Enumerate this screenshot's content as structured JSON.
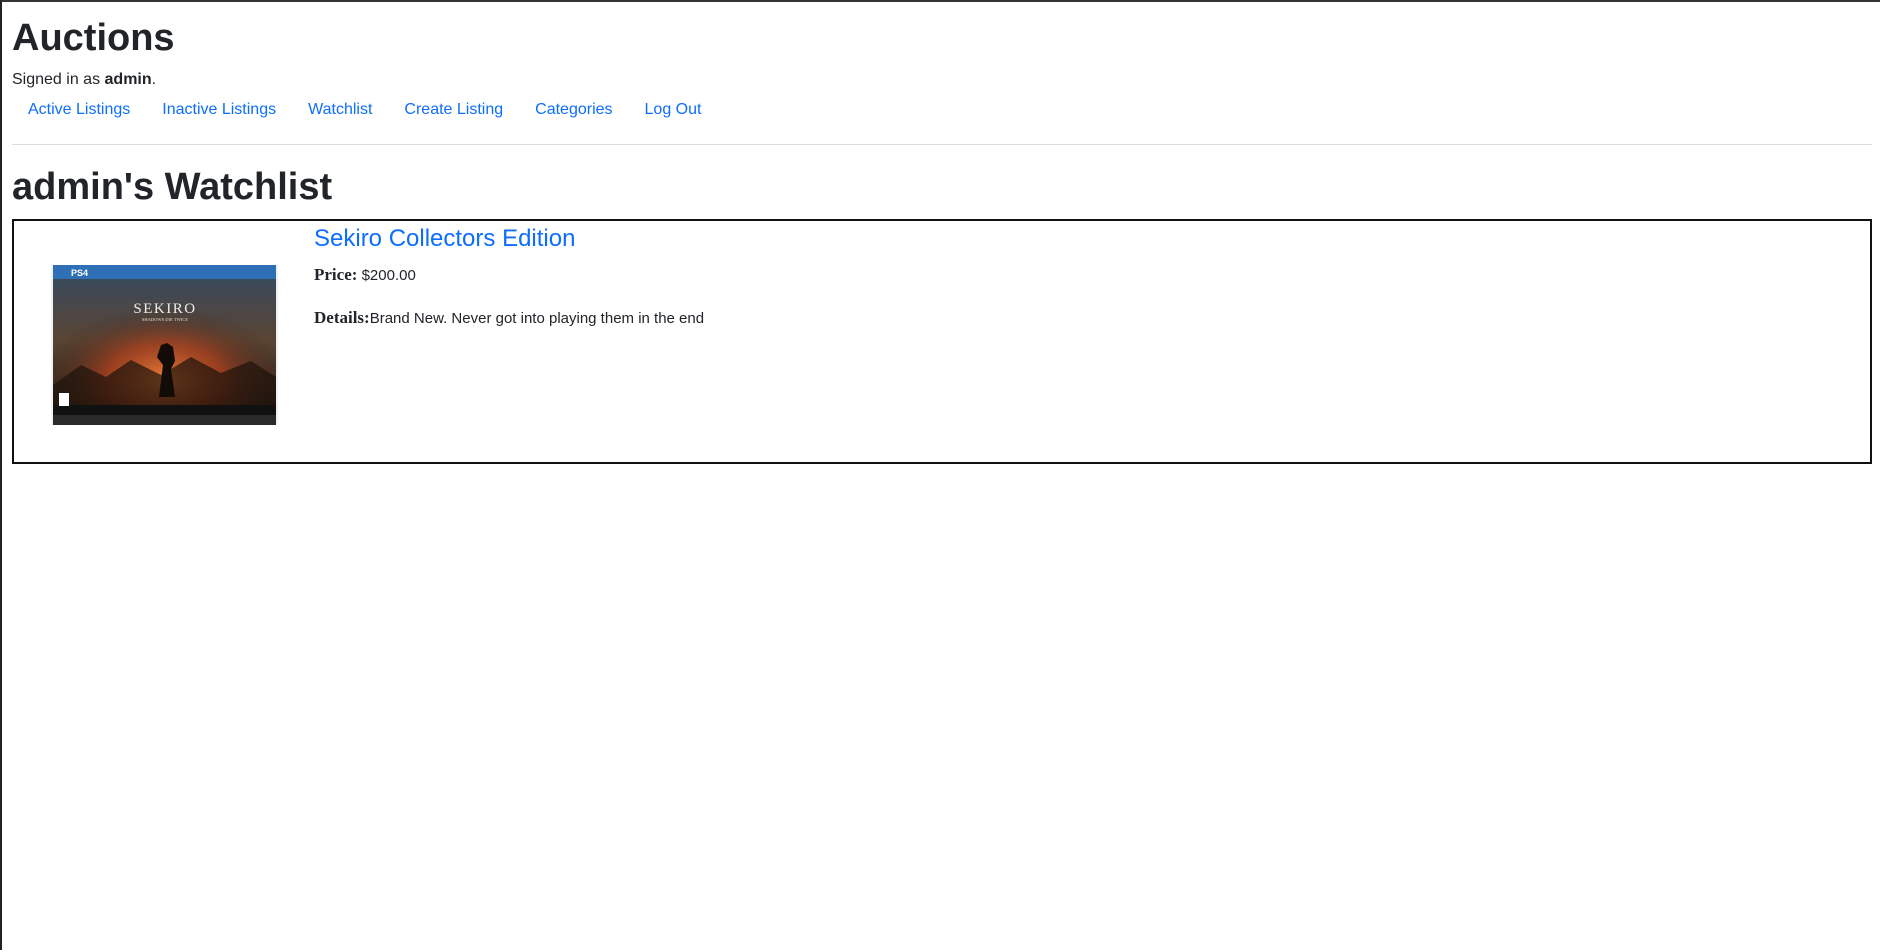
{
  "site": {
    "title": "Auctions",
    "signed_in_prefix": "Signed in as ",
    "username": "admin",
    "signed_in_suffix": "."
  },
  "nav": {
    "items": [
      {
        "label": "Active Listings"
      },
      {
        "label": "Inactive Listings"
      },
      {
        "label": "Watchlist"
      },
      {
        "label": "Create Listing"
      },
      {
        "label": "Categories"
      },
      {
        "label": "Log Out"
      }
    ]
  },
  "page": {
    "heading": "admin's Watchlist"
  },
  "listings": [
    {
      "title": "Sekiro Collectors Edition",
      "price_label": "Price:",
      "price": " $200.00",
      "details_label": "Details:",
      "details": "Brand New. Never got into playing them in the end",
      "image_text": {
        "platform": "PS4",
        "game_title": "SEKIRO",
        "subtitle": "SHADOWS DIE TWICE"
      }
    }
  ],
  "colors": {
    "link": "#0d6efd",
    "text": "#212529",
    "border": "#111111"
  }
}
